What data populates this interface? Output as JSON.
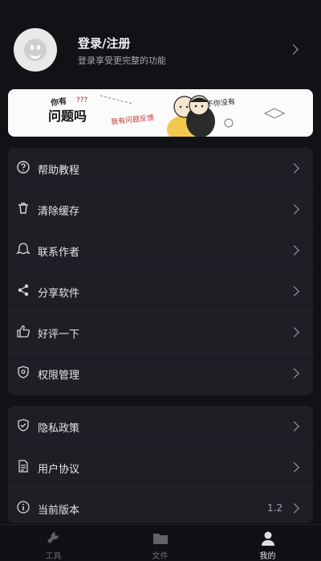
{
  "profile": {
    "title": "登录/注册",
    "subtitle": "登录享受更完整的功能"
  },
  "banner": {
    "line1": "你有",
    "line2": "问题吗",
    "marks": "???",
    "note_left": "我有问题反馈",
    "note_right": "不你没有"
  },
  "menu_group_1": [
    {
      "label": "帮助教程",
      "icon": "question-circle-icon"
    },
    {
      "label": "清除缓存",
      "icon": "trash-icon"
    },
    {
      "label": "联系作者",
      "icon": "chat-bubble-icon"
    },
    {
      "label": "分享软件",
      "icon": "share-icon"
    },
    {
      "label": "好评一下",
      "icon": "thumbs-up-icon"
    },
    {
      "label": "权限管理",
      "icon": "shield-icon"
    }
  ],
  "menu_group_2": [
    {
      "label": "隐私政策",
      "icon": "shield-check-icon"
    },
    {
      "label": "用户协议",
      "icon": "document-icon"
    },
    {
      "label": "当前版本",
      "icon": "info-icon",
      "value": "1.2"
    }
  ],
  "tabs": [
    {
      "label": "工具",
      "icon": "wrench-icon"
    },
    {
      "label": "文件",
      "icon": "folder-icon"
    },
    {
      "label": "我的",
      "icon": "user-icon"
    }
  ],
  "colors": {
    "background": "#111216",
    "card": "#1d1f25",
    "text": "#e5e6e8",
    "muted": "#a3a6ac"
  }
}
